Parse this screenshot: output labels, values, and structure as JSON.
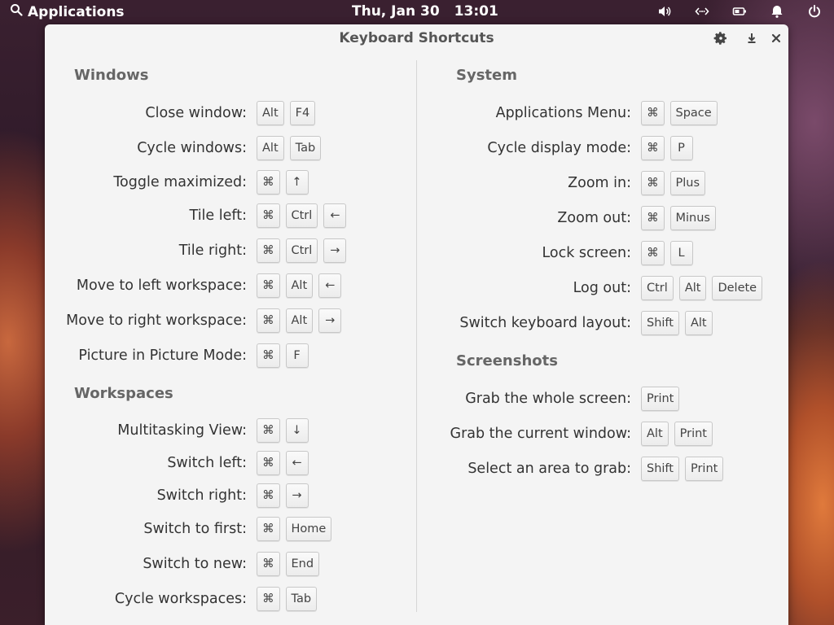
{
  "panel": {
    "applications_label": "Applications",
    "date": "Thu, Jan 30",
    "time": "13:01",
    "icons": [
      "search-icon",
      "volume-icon",
      "network-icon",
      "battery-icon",
      "notifications-icon",
      "power-icon"
    ]
  },
  "window": {
    "title": "Keyboard Shortcuts",
    "buttons": [
      "gear-icon",
      "download-icon",
      "close-icon"
    ]
  },
  "left": {
    "windows_title": "Windows",
    "windows": [
      {
        "label": "Close window:",
        "keys": [
          "Alt",
          "F4"
        ]
      },
      {
        "label": "Cycle windows:",
        "keys": [
          "Alt",
          "Tab"
        ]
      },
      {
        "label": "Toggle maximized:",
        "keys": [
          "⌘",
          "↑"
        ]
      },
      {
        "label": "Tile left:",
        "keys": [
          "⌘",
          "Ctrl",
          "←"
        ]
      },
      {
        "label": "Tile right:",
        "keys": [
          "⌘",
          "Ctrl",
          "→"
        ]
      },
      {
        "label": "Move to left workspace:",
        "keys": [
          "⌘",
          "Alt",
          "←"
        ]
      },
      {
        "label": "Move to right workspace:",
        "keys": [
          "⌘",
          "Alt",
          "→"
        ]
      },
      {
        "label": "Picture in Picture Mode:",
        "keys": [
          "⌘",
          "F"
        ]
      }
    ],
    "workspaces_title": "Workspaces",
    "workspaces": [
      {
        "label": "Multitasking View:",
        "keys": [
          "⌘",
          "↓"
        ]
      },
      {
        "label": "Switch left:",
        "keys": [
          "⌘",
          "←"
        ]
      },
      {
        "label": "Switch right:",
        "keys": [
          "⌘",
          "→"
        ]
      },
      {
        "label": "Switch to first:",
        "keys": [
          "⌘",
          "Home"
        ]
      },
      {
        "label": "Switch to new:",
        "keys": [
          "⌘",
          "End"
        ]
      },
      {
        "label": "Cycle workspaces:",
        "keys": [
          "⌘",
          "Tab"
        ]
      }
    ]
  },
  "right": {
    "system_title": "System",
    "system": [
      {
        "label": "Applications Menu:",
        "keys": [
          "⌘",
          "Space"
        ]
      },
      {
        "label": "Cycle display mode:",
        "keys": [
          "⌘",
          "P"
        ]
      },
      {
        "label": "Zoom in:",
        "keys": [
          "⌘",
          "Plus"
        ]
      },
      {
        "label": "Zoom out:",
        "keys": [
          "⌘",
          "Minus"
        ]
      },
      {
        "label": "Lock screen:",
        "keys": [
          "⌘",
          "L"
        ]
      },
      {
        "label": "Log out:",
        "keys": [
          "Ctrl",
          "Alt",
          "Delete"
        ]
      },
      {
        "label": "Switch keyboard layout:",
        "keys": [
          "Shift",
          "Alt"
        ]
      }
    ],
    "screenshots_title": "Screenshots",
    "screenshots": [
      {
        "label": "Grab the whole screen:",
        "keys": [
          "Print"
        ]
      },
      {
        "label": "Grab the current window:",
        "keys": [
          "Alt",
          "Print"
        ]
      },
      {
        "label": "Select an area to grab:",
        "keys": [
          "Shift",
          "Print"
        ]
      }
    ]
  }
}
